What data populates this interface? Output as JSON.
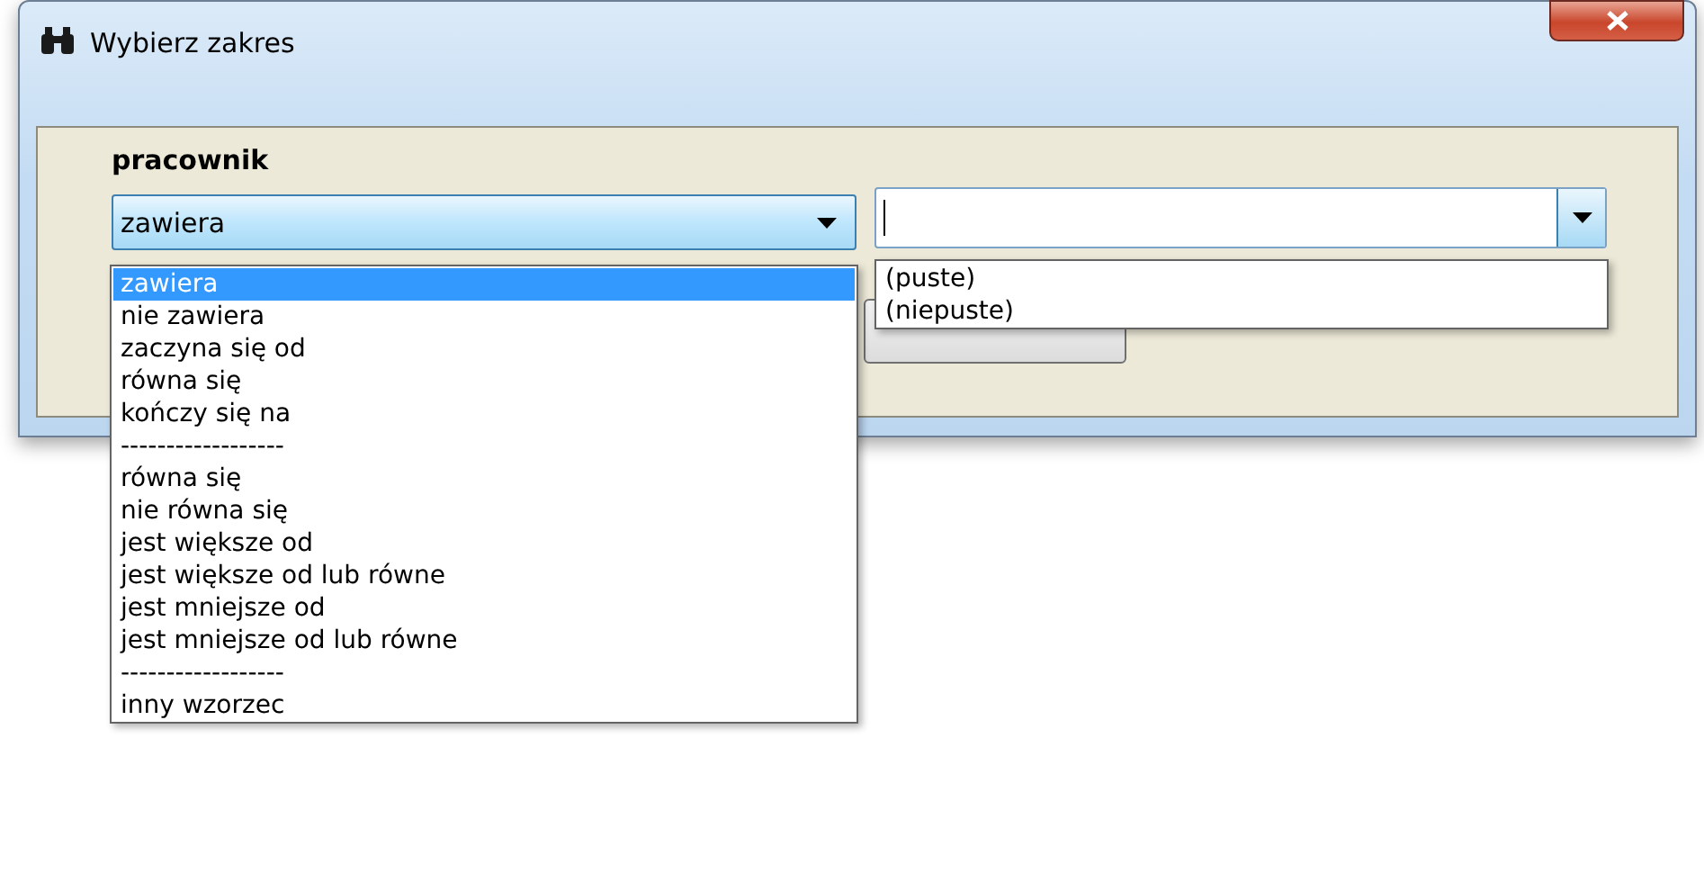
{
  "window": {
    "title": "Wybierz zakres"
  },
  "field_label": "pracownik",
  "condition_combo": {
    "value": "zawiera",
    "expanded": true,
    "options": [
      {
        "label": "zawiera",
        "selected": true
      },
      {
        "label": "nie zawiera",
        "selected": false
      },
      {
        "label": "zaczyna się od",
        "selected": false
      },
      {
        "label": "równa się",
        "selected": false
      },
      {
        "label": "kończy się na",
        "selected": false
      },
      {
        "label": "------------------",
        "selected": false
      },
      {
        "label": "równa się",
        "selected": false
      },
      {
        "label": "nie równa się",
        "selected": false
      },
      {
        "label": "jest większe od",
        "selected": false
      },
      {
        "label": "jest większe od lub równe",
        "selected": false
      },
      {
        "label": "jest mniejsze od",
        "selected": false
      },
      {
        "label": "jest mniejsze od lub równe",
        "selected": false
      },
      {
        "label": "------------------",
        "selected": false
      },
      {
        "label": "inny wzorzec",
        "selected": false
      }
    ]
  },
  "value_combo": {
    "expanded": true,
    "options": [
      {
        "label": "(puste)",
        "selected": false
      },
      {
        "label": "(niepuste)",
        "selected": false
      }
    ]
  }
}
